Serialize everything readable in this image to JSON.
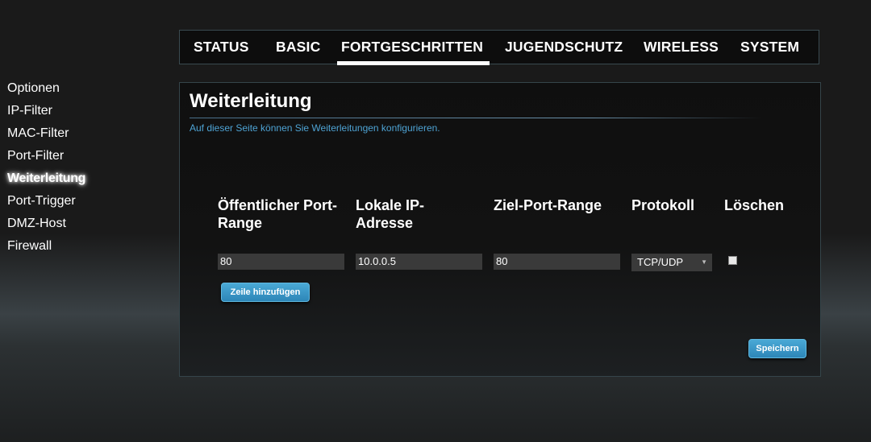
{
  "nav": {
    "tabs": [
      {
        "label": "STATUS"
      },
      {
        "label": "BASIC"
      },
      {
        "label": "FORTGESCHRITTEN",
        "active": true
      },
      {
        "label": "JUGENDSCHUTZ"
      },
      {
        "label": "WIRELESS"
      },
      {
        "label": "SYSTEM"
      }
    ]
  },
  "sidebar": {
    "items": [
      {
        "label": "Optionen"
      },
      {
        "label": "IP-Filter"
      },
      {
        "label": "MAC-Filter"
      },
      {
        "label": "Port-Filter"
      },
      {
        "label": "Weiterleitung",
        "active": true
      },
      {
        "label": "Port-Trigger"
      },
      {
        "label": "DMZ-Host"
      },
      {
        "label": "Firewall"
      }
    ]
  },
  "main": {
    "title": "Weiterleitung",
    "description": "Auf dieser Seite können Sie Weiterleitungen konfigurieren.",
    "table": {
      "headers": {
        "public_port_line1": "Öffentlicher Port-",
        "public_port_line2": "Range",
        "local_ip_line1": "Lokale IP-",
        "local_ip_line2": "Adresse",
        "target_port": "Ziel-Port-Range",
        "protocol": "Protokoll",
        "delete": "Löschen"
      },
      "rows": [
        {
          "public_port": "80",
          "local_ip": "10.0.0.5",
          "target_port": "80",
          "protocol": "TCP/UDP",
          "delete": false
        }
      ]
    },
    "add_row_label": "Zeile hinzufügen",
    "save_label": "Speichern"
  },
  "colors": {
    "accent": "#2d86b8",
    "description_text": "#4ea3d4",
    "panel_border": "#35454a"
  }
}
